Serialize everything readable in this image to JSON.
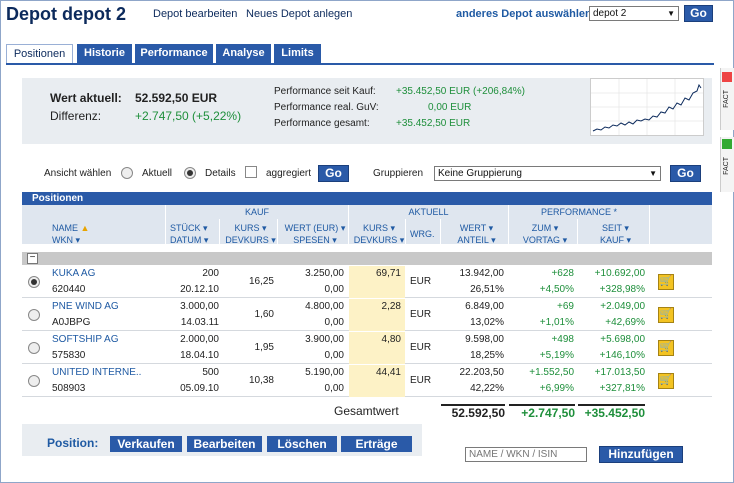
{
  "header": {
    "title": "Depot depot 2",
    "links": [
      "Depot bearbeiten",
      "Neues Depot anlegen"
    ],
    "select_label": "anderes Depot auswählen:",
    "select_value": "depot 2",
    "go_label": "Go"
  },
  "tabs": [
    "Positionen",
    "Historie",
    "Performance",
    "Analyse",
    "Limits"
  ],
  "summary": {
    "wert_label": "Wert aktuell:",
    "wert_value": "52.592,50 EUR",
    "diff_label": "Differenz:",
    "diff_value": "+2.747,50 (+5,22%)",
    "perf_kauf_label": "Performance seit Kauf:",
    "perf_kauf_value": "+35.452,50 EUR (+206,84%)",
    "perf_guv_label": "Performance real. GuV:",
    "perf_guv_value": "0,00 EUR",
    "perf_gesamt_label": "Performance gesamt:",
    "perf_gesamt_value": "+35.452,50 EUR"
  },
  "controls": {
    "ansicht_label": "Ansicht wählen",
    "aktuell_label": "Aktuell",
    "details_label": "Details",
    "aggregiert_label": "aggregiert",
    "go_label": "Go",
    "gruppieren_label": "Gruppieren",
    "gruppieren_value": "Keine Gruppierung"
  },
  "table": {
    "title": "Positionen",
    "groups": {
      "kauf": "KAUF",
      "aktuell": "AKTUELL",
      "performance": "PERFORMANCE *"
    },
    "cols": {
      "name": "NAME",
      "wkn": "WKN",
      "stueck": "STÜCK",
      "datum": "DATUM",
      "kurs": "KURS",
      "devkurs": "DEVKURS",
      "wert_eur": "WERT (EUR)",
      "spesen": "SPESEN",
      "kurs2": "KURS",
      "devkurs2": "DEVKURS",
      "wrg": "WRG.",
      "wert": "WERT",
      "anteil": "ANTEIL",
      "zum": "ZUM",
      "vortag": "VORTAG",
      "seit": "SEIT",
      "kauf": "KAUF"
    },
    "rows": [
      {
        "name": "KUKA AG",
        "wkn": "620440",
        "stueck": "200",
        "datum": "20.12.10",
        "kaufkurs": "16,25",
        "kaufwert": "3.250,00",
        "spesen": "0,00",
        "kurs": "69,71",
        "wrg": "EUR",
        "wert": "13.942,00",
        "anteil": "26,51%",
        "vortag_abs": "+628",
        "vortag_pct": "+4,50%",
        "seit_abs": "+10.692,00",
        "seit_pct": "+328,98%",
        "selected": true
      },
      {
        "name": "PNE WIND AG",
        "wkn": "A0JBPG",
        "stueck": "3.000,00",
        "datum": "14.03.11",
        "kaufkurs": "1,60",
        "kaufwert": "4.800,00",
        "spesen": "0,00",
        "kurs": "2,28",
        "wrg": "EUR",
        "wert": "6.849,00",
        "anteil": "13,02%",
        "vortag_abs": "+69",
        "vortag_pct": "+1,01%",
        "seit_abs": "+2.049,00",
        "seit_pct": "+42,69%",
        "selected": false
      },
      {
        "name": "SOFTSHIP AG",
        "wkn": "575830",
        "stueck": "2.000,00",
        "datum": "18.04.10",
        "kaufkurs": "1,95",
        "kaufwert": "3.900,00",
        "spesen": "0,00",
        "kurs": "4,80",
        "wrg": "EUR",
        "wert": "9.598,00",
        "anteil": "18,25%",
        "vortag_abs": "+498",
        "vortag_pct": "+5,19%",
        "seit_abs": "+5.698,00",
        "seit_pct": "+146,10%",
        "selected": false
      },
      {
        "name": "UNITED INTERNE..",
        "wkn": "508903",
        "stueck": "500",
        "datum": "05.09.10",
        "kaufkurs": "10,38",
        "kaufwert": "5.190,00",
        "spesen": "0,00",
        "kurs": "44,41",
        "wrg": "EUR",
        "wert": "22.203,50",
        "anteil": "42,22%",
        "vortag_abs": "+1.552,50",
        "vortag_pct": "+6,99%",
        "seit_abs": "+17.013,50",
        "seit_pct": "+327,81%",
        "selected": false
      }
    ],
    "total_label": "Gesamtwert",
    "total_wert": "52.592,50",
    "total_vortag": "+2.747,50",
    "total_seit": "+35.452,50"
  },
  "actions": {
    "label": "Position:",
    "buttons": [
      "Verkaufen",
      "Bearbeiten",
      "Löschen",
      "Erträge"
    ],
    "search_placeholder": "NAME / WKN / ISIN",
    "add_label": "Hinzufügen"
  },
  "sidebar_tabs": [
    "FACT",
    "FACT"
  ],
  "colors": {
    "accent": "#2a5aa8",
    "green": "#1e8f3b",
    "highlight": "#fdf2c6"
  }
}
